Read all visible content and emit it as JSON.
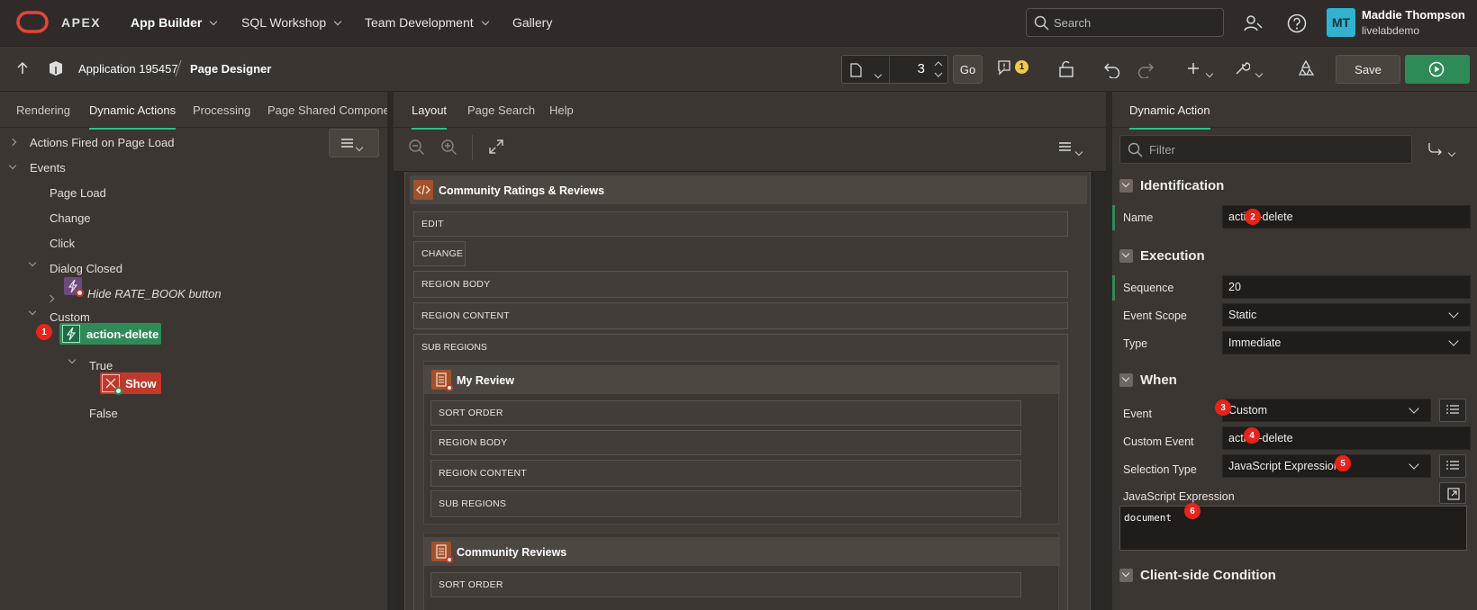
{
  "topnav": {
    "brand": "APEX",
    "menus": [
      "App Builder",
      "SQL Workshop",
      "Team Development",
      "Gallery"
    ],
    "search_placeholder": "Search",
    "user_initials": "MT",
    "user_name": "Maddie Thompson",
    "user_workspace": "livelabdemo"
  },
  "toolbar": {
    "app_label": "Application 195457",
    "page_designer_label": "Page Designer",
    "page_number": "3",
    "go_label": "Go",
    "warning_count": "1",
    "save_label": "Save"
  },
  "left_panel": {
    "tabs": [
      "Rendering",
      "Dynamic Actions",
      "Processing",
      "Page Shared Componen"
    ],
    "active_tab": "Dynamic Actions",
    "tree": {
      "actions_on_load": "Actions Fired on Page Load",
      "events": "Events",
      "page_load": "Page Load",
      "change": "Change",
      "click": "Click",
      "dialog_closed": "Dialog Closed",
      "hide_rate": "Hide RATE_BOOK button",
      "custom": "Custom",
      "action_delete": "action-delete",
      "true_label": "True",
      "show_label": "Show",
      "false_label": "False"
    },
    "callout_1": "1"
  },
  "center_panel": {
    "tabs": [
      "Layout",
      "Page Search",
      "Help"
    ],
    "active_tab": "Layout",
    "region_title": "Community Ratings & Reviews",
    "slots": [
      "EDIT",
      "CHANGE",
      "REGION BODY",
      "REGION CONTENT",
      "SUB REGIONS"
    ],
    "sub1_title": "My Review",
    "sub1_slots": [
      "SORT ORDER",
      "REGION BODY",
      "REGION CONTENT",
      "SUB REGIONS"
    ],
    "sub2_title": "Community Reviews",
    "sub2_slots": [
      "SORT ORDER"
    ]
  },
  "right_panel": {
    "tab": "Dynamic Action",
    "filter_placeholder": "Filter",
    "sections": {
      "identification": "Identification",
      "execution": "Execution",
      "when": "When",
      "client_condition": "Client-side Condition"
    },
    "fields": {
      "name_label": "Name",
      "name_value": "action-delete",
      "sequence_label": "Sequence",
      "sequence_value": "20",
      "scope_label": "Event Scope",
      "scope_value": "Static",
      "type_label": "Type",
      "type_value": "Immediate",
      "event_label": "Event",
      "event_value": "Custom",
      "custom_event_label": "Custom Event",
      "custom_event_value": "action-delete",
      "selection_label": "Selection Type",
      "selection_value": "JavaScript Expression",
      "js_label": "JavaScript Expression",
      "js_value": "document"
    },
    "callouts": [
      "2",
      "3",
      "4",
      "5",
      "6"
    ]
  },
  "colors": {
    "accent_green": "#2e8b57",
    "callout_red": "#e8231b",
    "show_red": "#c0392b",
    "warning_yellow": "#f2c94c"
  }
}
